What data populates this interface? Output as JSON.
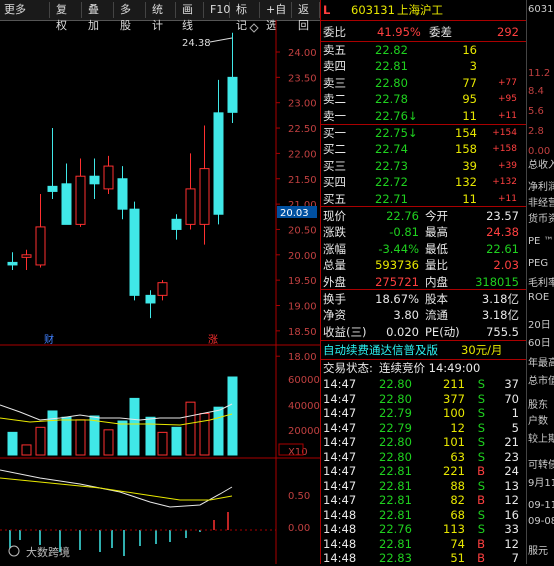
{
  "toolbar": {
    "items": [
      "更多",
      "复权",
      "叠加",
      "多股",
      "统计",
      "画线",
      "F10",
      "标记",
      "+自选",
      "返回"
    ]
  },
  "chart": {
    "price_axis": [
      "24.00",
      "23.50",
      "23.00",
      "22.50",
      "22.00",
      "21.50",
      "21.00",
      "20.50",
      "20.00",
      "19.50",
      "19.00",
      "18.50",
      "18.00"
    ],
    "high_marker": "24.38",
    "current_price_tag": "20.03",
    "marker_cai": "财",
    "marker_zhang": "涨",
    "volume_axis": [
      "60000",
      "40000",
      "20000",
      "X10"
    ],
    "macd_axis": [
      "0.50",
      "0.00"
    ],
    "watermark": "大数跨境"
  },
  "chart_data": {
    "type": "candlestick",
    "series": [
      {
        "o": 19.85,
        "c": 19.8,
        "h": 20.05,
        "l": 19.7,
        "up": false
      },
      {
        "o": 19.95,
        "c": 20.0,
        "h": 20.1,
        "l": 19.7,
        "up": true
      },
      {
        "o": 19.8,
        "c": 20.55,
        "h": 21.2,
        "l": 19.75,
        "up": true
      },
      {
        "o": 21.35,
        "c": 21.25,
        "h": 22.5,
        "l": 21.1,
        "up": false
      },
      {
        "o": 21.4,
        "c": 20.6,
        "h": 21.8,
        "l": 20.6,
        "up": false
      },
      {
        "o": 20.6,
        "c": 21.55,
        "h": 21.9,
        "l": 20.55,
        "up": true
      },
      {
        "o": 21.55,
        "c": 21.4,
        "h": 21.9,
        "l": 21.1,
        "up": false
      },
      {
        "o": 21.3,
        "c": 21.75,
        "h": 21.95,
        "l": 21.2,
        "up": true
      },
      {
        "o": 21.5,
        "c": 20.9,
        "h": 21.75,
        "l": 20.7,
        "up": false
      },
      {
        "o": 20.9,
        "c": 19.2,
        "h": 21.05,
        "l": 19.1,
        "up": false
      },
      {
        "o": 19.2,
        "c": 19.05,
        "h": 19.3,
        "l": 18.75,
        "up": false
      },
      {
        "o": 19.2,
        "c": 19.45,
        "h": 19.5,
        "l": 19.1,
        "up": true
      },
      {
        "o": 20.7,
        "c": 20.5,
        "h": 20.8,
        "l": 20.3,
        "up": false
      },
      {
        "o": 20.6,
        "c": 21.3,
        "h": 22.0,
        "l": 20.5,
        "up": true
      },
      {
        "o": 20.6,
        "c": 21.7,
        "h": 22.55,
        "l": 20.2,
        "up": true
      },
      {
        "o": 22.8,
        "c": 20.8,
        "h": 23.45,
        "l": 20.6,
        "up": false
      },
      {
        "o": 23.5,
        "c": 22.81,
        "h": 24.38,
        "l": 22.6,
        "up": false
      }
    ],
    "volume": [
      18000,
      8000,
      22000,
      35000,
      30000,
      28000,
      31000,
      20000,
      27000,
      45000,
      30000,
      18000,
      22000,
      42000,
      33000,
      38000,
      62000
    ]
  },
  "quote": {
    "code": "603131",
    "name": "上海沪工",
    "webi_label": "委比",
    "webi_value": "41.95%",
    "weicha_label": "委差",
    "weicha_value": "292",
    "sell": [
      {
        "label": "卖五",
        "price": "22.82",
        "vol": "16",
        "chg": ""
      },
      {
        "label": "卖四",
        "price": "22.81",
        "vol": "3",
        "chg": ""
      },
      {
        "label": "卖三",
        "price": "22.80",
        "vol": "77",
        "chg": "+77"
      },
      {
        "label": "卖二",
        "price": "22.78",
        "vol": "95",
        "chg": "+95"
      },
      {
        "label": "卖一",
        "price": "22.76↓",
        "vol": "11",
        "chg": "+11"
      }
    ],
    "buy": [
      {
        "label": "买一",
        "price": "22.75↓",
        "vol": "154",
        "chg": "+154"
      },
      {
        "label": "买二",
        "price": "22.74",
        "vol": "158",
        "chg": "+158"
      },
      {
        "label": "买三",
        "price": "22.73",
        "vol": "39",
        "chg": "+39"
      },
      {
        "label": "买四",
        "price": "22.72",
        "vol": "132",
        "chg": "+132"
      },
      {
        "label": "买五",
        "price": "22.71",
        "vol": "11",
        "chg": "+11"
      }
    ],
    "stats": [
      {
        "l1": "现价",
        "v1": "22.76",
        "c1": "green",
        "l2": "今开",
        "v2": "23.57",
        "c2": "white"
      },
      {
        "l1": "涨跌",
        "v1": "-0.81",
        "c1": "green",
        "l2": "最高",
        "v2": "24.38",
        "c2": "red"
      },
      {
        "l1": "涨幅",
        "v1": "-3.44%",
        "c1": "green",
        "l2": "最低",
        "v2": "22.61",
        "c2": "green"
      },
      {
        "l1": "总量",
        "v1": "593736",
        "c1": "yellow",
        "l2": "量比",
        "v2": "2.03",
        "c2": "red"
      },
      {
        "l1": "外盘",
        "v1": "275721",
        "c1": "red",
        "l2": "内盘",
        "v2": "318015",
        "c2": "green"
      }
    ],
    "stats2": [
      {
        "l1": "换手",
        "v1": "18.67%",
        "l2": "股本",
        "v2": "3.18亿"
      },
      {
        "l1": "净资",
        "v1": "3.80",
        "l2": "流通",
        "v2": "3.18亿"
      },
      {
        "l1": "收益(三)",
        "v1": "0.020",
        "l2": "PE(动)",
        "v2": "755.5"
      }
    ],
    "ad_text": "自动续费通达信普及版",
    "ad_price": "30元/月",
    "trade_status_label": "交易状态:",
    "trade_status_value": "连续竞价 14:49:00",
    "ticks": [
      {
        "t": "14:47",
        "p": "22.80",
        "v": "211",
        "s": "S",
        "n": "37"
      },
      {
        "t": "14:47",
        "p": "22.80",
        "v": "377",
        "s": "S",
        "n": "70"
      },
      {
        "t": "14:47",
        "p": "22.79",
        "v": "100",
        "s": "S",
        "n": "1"
      },
      {
        "t": "14:47",
        "p": "22.79",
        "v": "12",
        "s": "S",
        "n": "5"
      },
      {
        "t": "14:47",
        "p": "22.80",
        "v": "101",
        "s": "S",
        "n": "21"
      },
      {
        "t": "14:47",
        "p": "22.80",
        "v": "63",
        "s": "S",
        "n": "23"
      },
      {
        "t": "14:47",
        "p": "22.81",
        "v": "221",
        "s": "B",
        "n": "24"
      },
      {
        "t": "14:47",
        "p": "22.81",
        "v": "88",
        "s": "S",
        "n": "13"
      },
      {
        "t": "14:47",
        "p": "22.81",
        "v": "82",
        "s": "B",
        "n": "12"
      },
      {
        "t": "14:48",
        "p": "22.81",
        "v": "68",
        "s": "S",
        "n": "16"
      },
      {
        "t": "14:48",
        "p": "22.76",
        "v": "113",
        "s": "S",
        "n": "33"
      },
      {
        "t": "14:48",
        "p": "22.81",
        "v": "74",
        "s": "B",
        "n": "12"
      },
      {
        "t": "14:48",
        "p": "22.83",
        "v": "51",
        "s": "B",
        "n": "7"
      }
    ]
  },
  "sidebar_right": {
    "items": [
      "6031",
      "11.2",
      "8.4",
      "5.6",
      "2.8",
      "0.00",
      "总收入",
      "净利润",
      "非经营",
      "货币资",
      "PE ™",
      "PEG",
      "毛利率",
      "ROE",
      "20日",
      "60日",
      "年最高",
      "总市值",
      "股东",
      "户数",
      "较上期",
      "可转债",
      "9月11",
      "09-11",
      "09-08",
      "服元"
    ]
  }
}
